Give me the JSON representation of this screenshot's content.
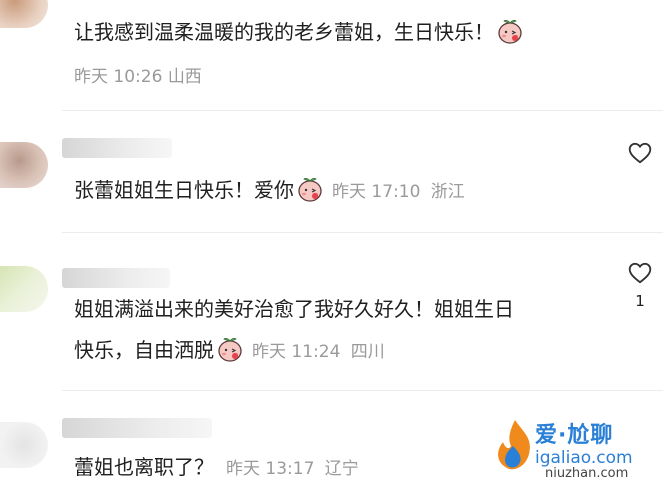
{
  "comments": [
    {
      "text": "让我感到温柔温暖的我的老乡蕾姐，生日快乐！",
      "time": "昨天 10:26",
      "location": "山西"
    },
    {
      "text": "张蕾姐姐生日快乐！爱你",
      "time": "昨天 17:10",
      "location": "浙江"
    },
    {
      "text_line1": "姐姐满溢出来的美好治愈了我好久好久！姐姐生日",
      "text_line2": "快乐，自由洒脱",
      "time": "昨天 11:24",
      "location": "四川",
      "likes": "1"
    },
    {
      "text": "蕾姐也离职了？",
      "time": "昨天 13:17",
      "location": "辽宁"
    }
  ],
  "icons": {
    "like": "heart-outline-icon",
    "emoji": "peach-face-emoji-icon"
  },
  "watermark": {
    "title": "爱·尬聊",
    "url": "igaliao.com",
    "footer": "niuzhan.com"
  },
  "colors": {
    "meta": "#9a9a9a",
    "text": "#1f1f1f",
    "watermark": "#2a7fd6"
  }
}
